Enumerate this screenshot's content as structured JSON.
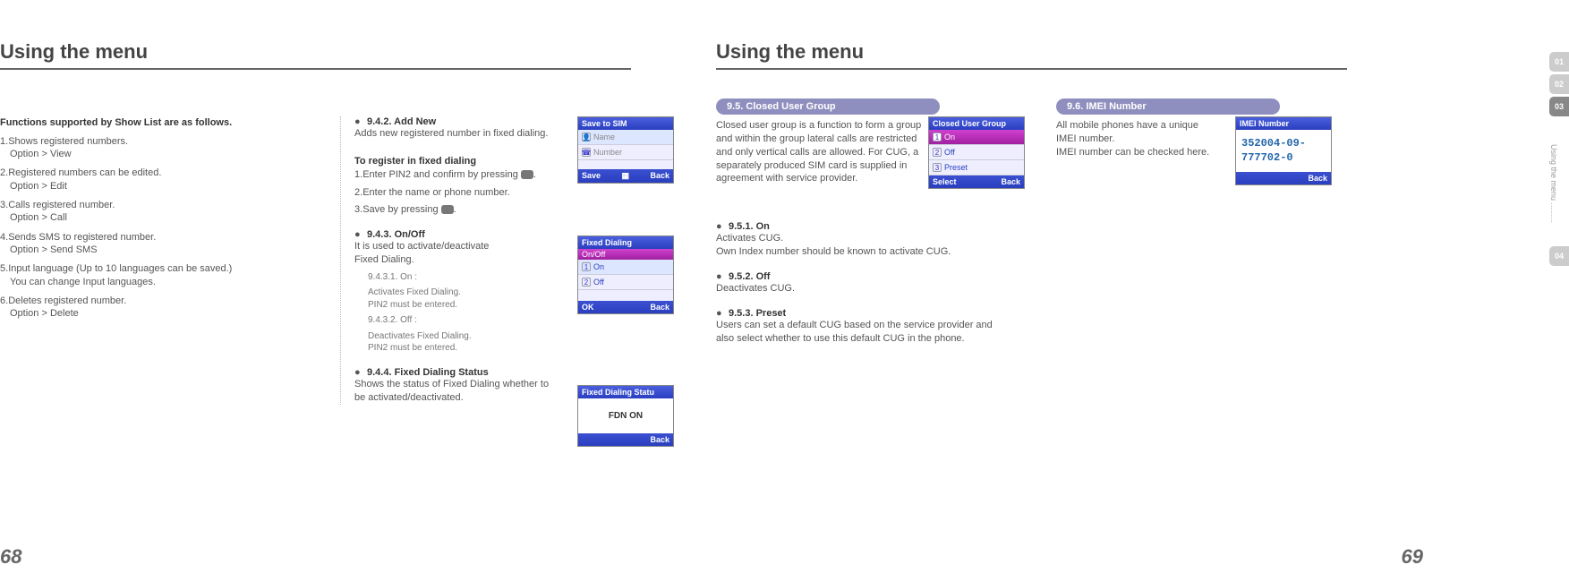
{
  "left": {
    "title": "Using the menu",
    "func_heading": "Functions supported by Show List are as follows.",
    "items": [
      {
        "n": "1.",
        "t": "Shows registered numbers.",
        "s": "Option > View"
      },
      {
        "n": "2.",
        "t": "Registered numbers can be edited.",
        "s": "Option > Edit"
      },
      {
        "n": "3.",
        "t": "Calls registered number.",
        "s": "Option > Call"
      },
      {
        "n": "4.",
        "t": "Sends SMS to registered number.",
        "s": "Option > Send SMS"
      },
      {
        "n": "5.",
        "t": "Input language (Up to 10 languages can be saved.)",
        "s": "You can change Input languages."
      },
      {
        "n": "6.",
        "t": "Deletes registered number.",
        "s": "Option > Delete"
      }
    ],
    "s942_t": "9.4.2. Add New",
    "s942_b": "Adds new registered number in fixed dialing.",
    "reg_h": "To register in fixed dialing",
    "reg1_a": "Enter PIN2 and confirm by pressing ",
    "reg1_b": ".",
    "reg2": "Enter the name or phone number.",
    "reg3_a": "Save by pressing ",
    "reg3_b": ".",
    "s943_t": "9.4.3. On/Off",
    "s943_b": "It is used to activate/deactivate",
    "s943_c": "Fixed Dialing.",
    "s9431_t": "9.4.3.1. On :",
    "s9431_a": "Activates Fixed Dialing.",
    "s9431_b": "PIN2 must be entered.",
    "s9432_t": "9.4.3.2. Off :",
    "s9432_a": "Deactivates Fixed Dialing.",
    "s9432_b": "PIN2 must be entered.",
    "s944_t": "9.4.4. Fixed Dialing Status",
    "s944_b": "Shows the status of Fixed Dialing whether to be activated/deactivated.",
    "page": "68"
  },
  "right": {
    "title": "Using the menu",
    "pill95": "9.5. Closed User Group",
    "p95": "Closed user group is a function to form a group and within the group lateral calls are restricted and only vertical calls are allowed. For CUG, a separately produced SIM card is supplied in agreement with service provider.",
    "s951_t": "9.5.1. On",
    "s951_a": "Activates CUG.",
    "s951_b": "Own Index number should be known to activate CUG.",
    "s952_t": "9.5.2. Off",
    "s952_a": "Deactivates CUG.",
    "s953_t": "9.5.3. Preset",
    "s953_a": "Users can set a default CUG based on the service provider and also select whether to use this default CUG in the phone.",
    "pill96": "9.6. IMEI Number",
    "p96a": "All mobile phones have a unique IMEI number.",
    "p96b": "IMEI number can be checked here.",
    "page": "69"
  },
  "ss": {
    "sim": {
      "title": "Save to SIM",
      "r1": "Name",
      "r2": "Number",
      "left": "Save",
      "right": "Back"
    },
    "fd": {
      "title": "Fixed Dialing",
      "sub": "On/Off",
      "r1": "On",
      "r2": "Off",
      "left": "OK",
      "right": "Back"
    },
    "fds": {
      "title": "Fixed Dialing Statu",
      "body": "FDN ON",
      "right": "Back"
    },
    "cug": {
      "title": "Closed User Group",
      "r1": "On",
      "r2": "Off",
      "r3": "Preset",
      "left": "Select",
      "right": "Back"
    },
    "imei": {
      "title": "IMEI Number",
      "l1": "352004-09-",
      "l2": "777702-0",
      "right": "Back"
    }
  },
  "tabs": {
    "t1": "01",
    "t2": "02",
    "t3": "03",
    "t4": "04",
    "label": "Using the menu ........."
  }
}
